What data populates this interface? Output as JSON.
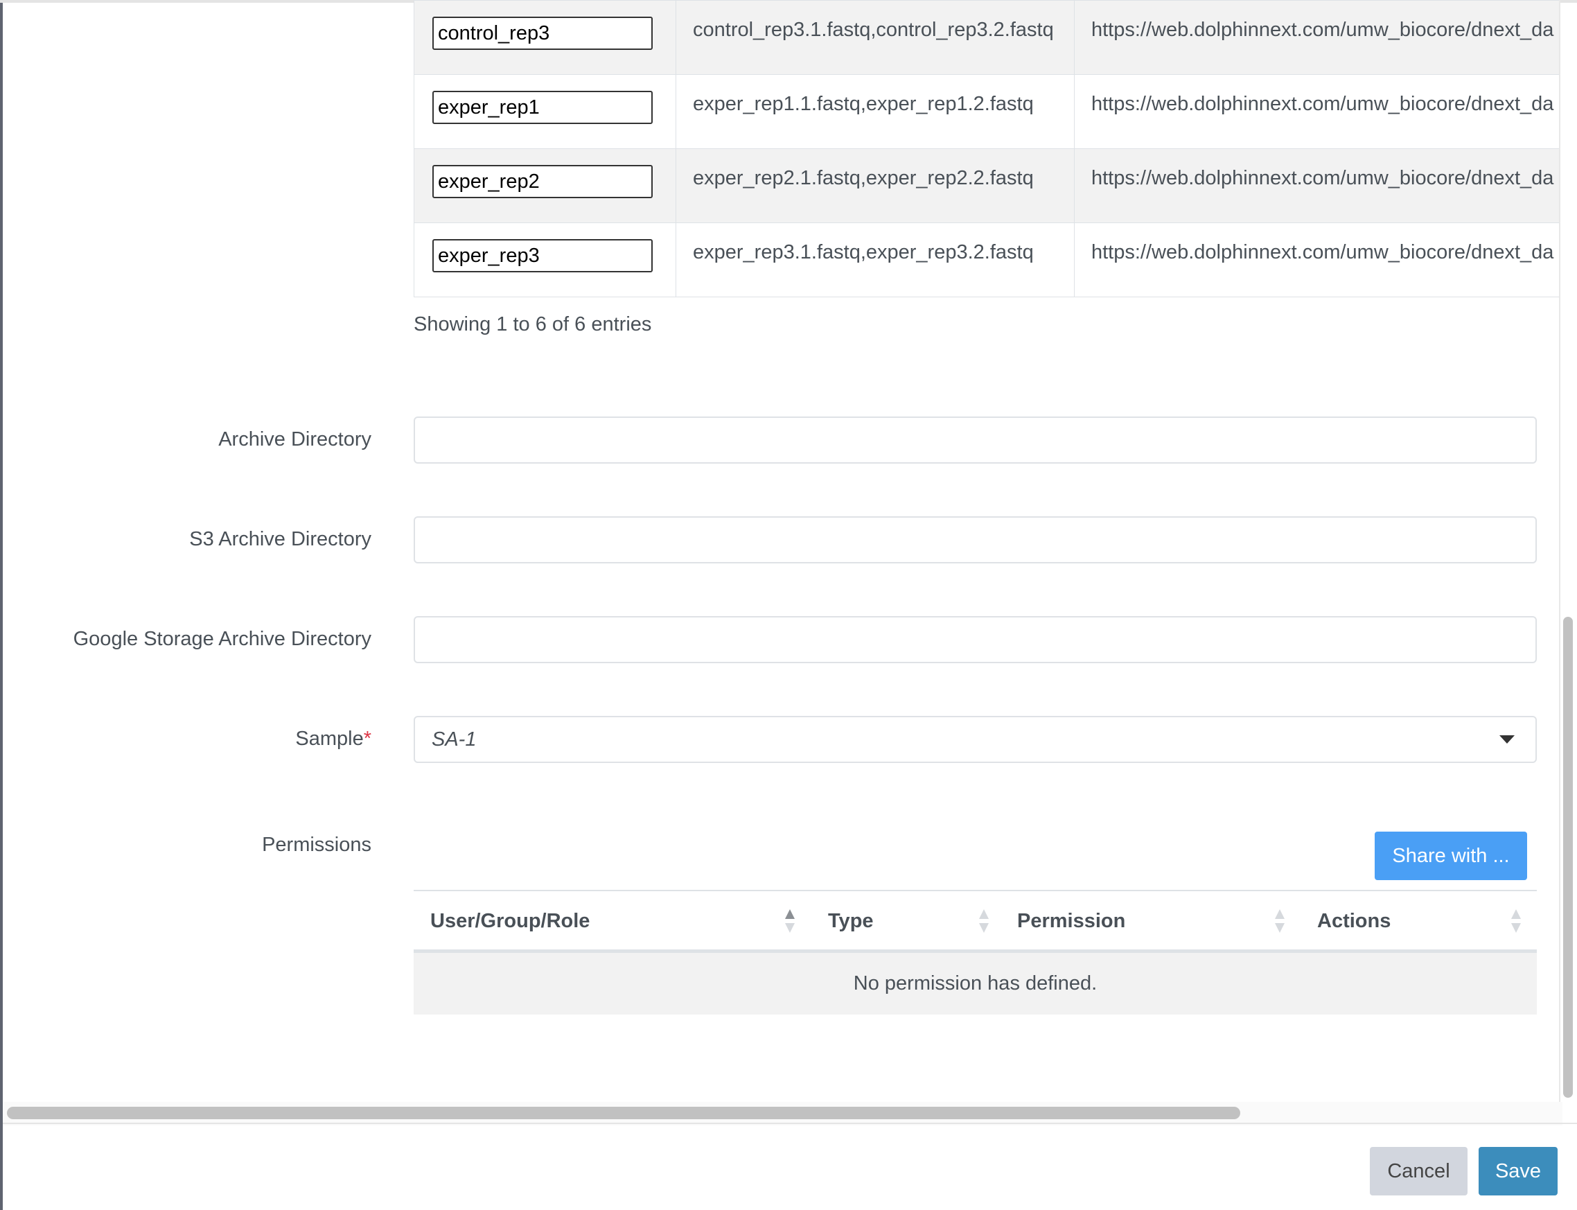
{
  "files_table": {
    "rows": [
      {
        "name": "control_rep3",
        "files": "control_rep3.1.fastq,control_rep3.2.fastq",
        "url": "https://web.dolphinnext.com/umw_biocore/dnext_da"
      },
      {
        "name": "exper_rep1",
        "files": "exper_rep1.1.fastq,exper_rep1.2.fastq",
        "url": "https://web.dolphinnext.com/umw_biocore/dnext_da"
      },
      {
        "name": "exper_rep2",
        "files": "exper_rep2.1.fastq,exper_rep2.2.fastq",
        "url": "https://web.dolphinnext.com/umw_biocore/dnext_da"
      },
      {
        "name": "exper_rep3",
        "files": "exper_rep3.1.fastq,exper_rep3.2.fastq",
        "url": "https://web.dolphinnext.com/umw_biocore/dnext_da"
      }
    ],
    "showing": "Showing 1 to 6 of 6 entries"
  },
  "form": {
    "archive_dir_label": "Archive Directory",
    "archive_dir_value": "",
    "s3_archive_label": "S3 Archive Directory",
    "s3_archive_value": "",
    "gs_archive_label": "Google Storage Archive Directory",
    "gs_archive_value": "",
    "sample_label": "Sample",
    "sample_required_mark": "*",
    "sample_value": "SA-1",
    "permissions_label": "Permissions"
  },
  "permissions": {
    "share_button": "Share with ...",
    "columns": [
      "User/Group/Role",
      "Type",
      "Permission",
      "Actions"
    ],
    "sorted_column": "User/Group/Role",
    "empty_text": "No permission has defined."
  },
  "footer": {
    "cancel": "Cancel",
    "save": "Save"
  },
  "colors": {
    "share_button": "#4a9ff5",
    "save_button": "#3c8dbc",
    "cancel_button": "#d2d6de",
    "required": "#dc3545"
  }
}
